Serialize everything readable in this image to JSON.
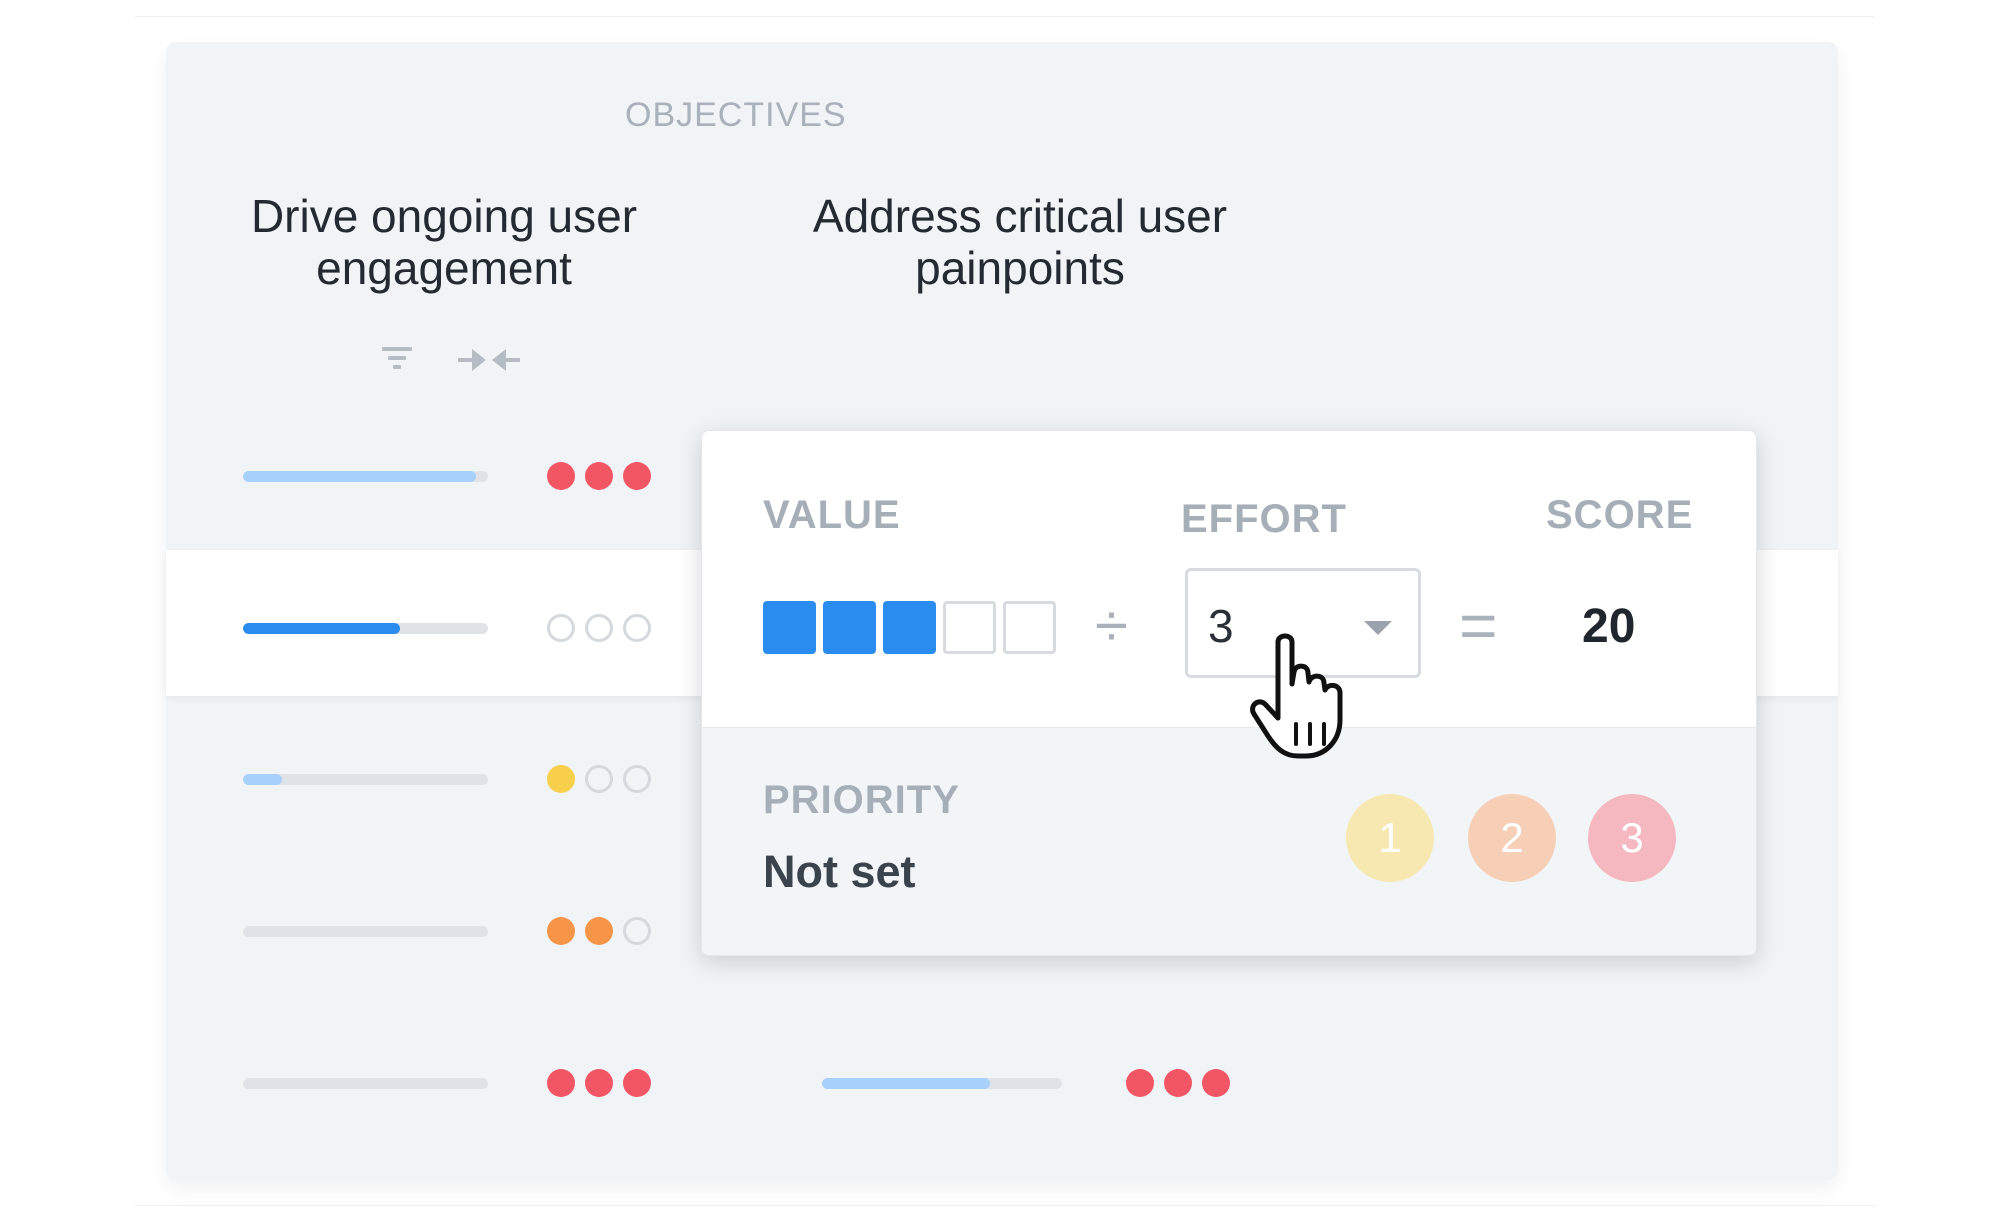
{
  "objectives": {
    "section_title": "OBJECTIVES",
    "columns": [
      {
        "line1": "Drive ongoing user",
        "line2": "engagement"
      },
      {
        "line1": "Address critical user",
        "line2": "painpoints"
      }
    ],
    "tools": [
      {
        "icon": "filter-icon"
      },
      {
        "icon": "collapse-icon"
      }
    ]
  },
  "rows": [
    {
      "progress": 0.95,
      "bar_color": "#a7d0fa",
      "dots": [
        "#f25564",
        "#f25564",
        "#f25564"
      ]
    },
    {
      "progress": 0.64,
      "bar_color": "#2b8cf0",
      "dots": [
        "empty",
        "empty",
        "empty"
      ]
    },
    {
      "progress": 0.16,
      "bar_color": "#a7d0fa",
      "dots": [
        "#f8cf4b",
        "empty",
        "empty"
      ]
    },
    {
      "progress": 0.0,
      "bar_color": "#a7d0fa",
      "dots": [
        "#f69447",
        "#f69447",
        "empty"
      ]
    },
    {
      "progress": 0.0,
      "bar_color": "#a7d0fa",
      "dots": [
        "#f25564",
        "#f25564",
        "#f25564"
      ],
      "second": {
        "progress": 0.7,
        "bar_color": "#a7d0fa",
        "dots": [
          "#f25564",
          "#f25564",
          "#f25564"
        ]
      }
    }
  ],
  "popover": {
    "value_label": "VALUE",
    "effort_label": "EFFORT",
    "score_label": "SCORE",
    "value_rating": 3,
    "value_max": 5,
    "divide_symbol": "÷",
    "equals_symbol": "=",
    "effort_value": "3",
    "score_value": "20",
    "priority_label": "PRIORITY",
    "priority_value": "Not set",
    "priority_options": [
      {
        "label": "1",
        "color": "#f7e8b1"
      },
      {
        "label": "2",
        "color": "#f6cfb6"
      },
      {
        "label": "3",
        "color": "#f5b7c0"
      }
    ]
  },
  "colors": {
    "accent": "#2b8cf0",
    "empty_dot_border": "#d4d9de"
  }
}
